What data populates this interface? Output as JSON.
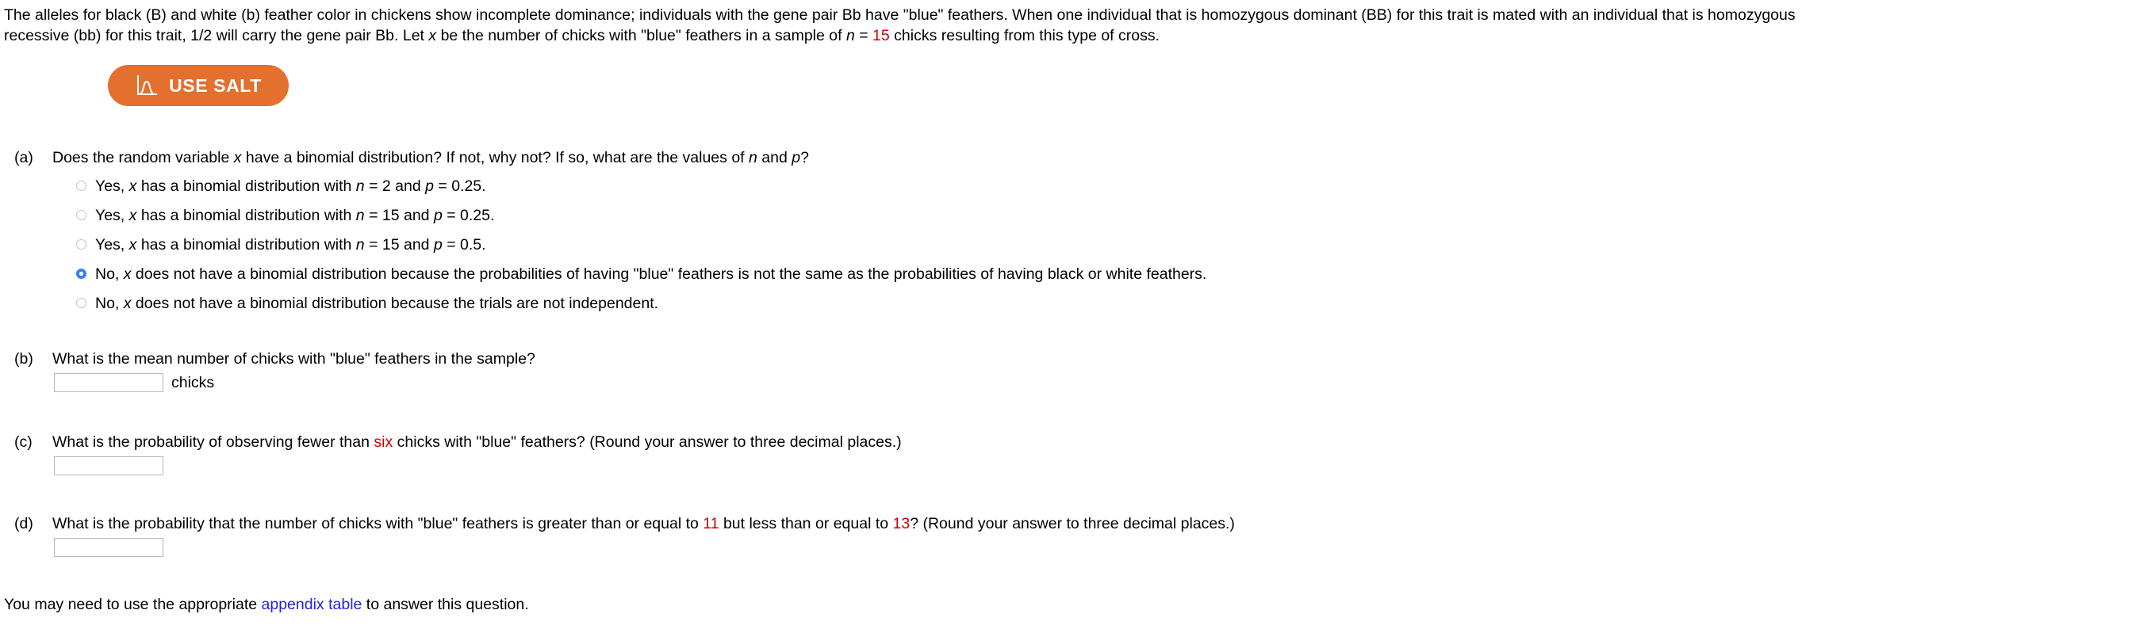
{
  "intro": {
    "line1_a": "The alleles for black (B) and white (b) feather color in chickens show incomplete dominance; individuals with the gene pair Bb have \"blue\" feathers. When one individual that is homozygous dominant (BB) for this trait is mated with an individual that is homozygous",
    "line2_a": "recessive (bb) for this trait, 1/2 will carry the gene pair Bb. Let ",
    "line2_var_x": "x",
    "line2_b": " be the number of chicks with \"blue\" feathers in a sample of ",
    "line2_var_n": "n",
    "line2_eq": " = ",
    "line2_n_value": "15",
    "line2_c": " chicks resulting from this type of cross."
  },
  "salt": {
    "label": "USE SALT",
    "icon": "distribution-curve-icon",
    "color": "#e3702e"
  },
  "question_a": {
    "label": "(a)",
    "text_1": "Does the random variable ",
    "var_x": "x",
    "text_2": " have a binomial distribution? If not, why not? If so, what are the values of ",
    "var_n": "n",
    "text_3": " and ",
    "var_p": "p",
    "text_4": "?",
    "options": [
      {
        "id": "opt-1",
        "selected": false,
        "parts": [
          {
            "t": "Yes, ",
            "s": "plain"
          },
          {
            "t": "x",
            "s": "italic"
          },
          {
            "t": " has a binomial distribution with ",
            "s": "plain"
          },
          {
            "t": "n",
            "s": "italic"
          },
          {
            "t": " = 2 and ",
            "s": "plain"
          },
          {
            "t": "p",
            "s": "italic"
          },
          {
            "t": " = 0.25.",
            "s": "plain"
          }
        ]
      },
      {
        "id": "opt-2",
        "selected": false,
        "parts": [
          {
            "t": "Yes, ",
            "s": "plain"
          },
          {
            "t": "x",
            "s": "italic"
          },
          {
            "t": " has a binomial distribution with ",
            "s": "plain"
          },
          {
            "t": "n",
            "s": "italic"
          },
          {
            "t": " = 15 and ",
            "s": "plain"
          },
          {
            "t": "p",
            "s": "italic"
          },
          {
            "t": " = 0.25.",
            "s": "plain"
          }
        ]
      },
      {
        "id": "opt-3",
        "selected": false,
        "parts": [
          {
            "t": "Yes, ",
            "s": "plain"
          },
          {
            "t": "x",
            "s": "italic"
          },
          {
            "t": " has a binomial distribution with ",
            "s": "plain"
          },
          {
            "t": "n",
            "s": "italic"
          },
          {
            "t": " = 15 and ",
            "s": "plain"
          },
          {
            "t": "p",
            "s": "italic"
          },
          {
            "t": " = 0.5.",
            "s": "plain"
          }
        ]
      },
      {
        "id": "opt-4",
        "selected": true,
        "parts": [
          {
            "t": "No, ",
            "s": "plain"
          },
          {
            "t": "x",
            "s": "italic"
          },
          {
            "t": " does not have a binomial distribution because the probabilities of having \"blue\" feathers is not the same as the probabilities of having black or white feathers.",
            "s": "plain"
          }
        ]
      },
      {
        "id": "opt-5",
        "selected": false,
        "parts": [
          {
            "t": "No, ",
            "s": "plain"
          },
          {
            "t": "x",
            "s": "italic"
          },
          {
            "t": " does not have a binomial distribution because the trials are not independent.",
            "s": "plain"
          }
        ]
      }
    ]
  },
  "question_b": {
    "label": "(b)",
    "text": "What is the mean number of chicks with \"blue\" feathers in the sample?",
    "answer_value": "",
    "unit": "chicks"
  },
  "question_c": {
    "label": "(c)",
    "text_1": "What is the probability of observing fewer than ",
    "highlight": "six",
    "text_2": " chicks with \"blue\" feathers? (Round your answer to three decimal places.)",
    "answer_value": ""
  },
  "question_d": {
    "label": "(d)",
    "text_1": "What is the probability that the number of chicks with \"blue\" feathers is greater than or equal to ",
    "highlight_1": "11",
    "text_2": " but less than or equal to ",
    "highlight_2": "13",
    "text_3": "? (Round your answer to three decimal places.)",
    "answer_value": ""
  },
  "footer": {
    "text_1": "You may need to use the appropriate ",
    "link_text": "appendix table",
    "text_2": " to answer this question."
  }
}
